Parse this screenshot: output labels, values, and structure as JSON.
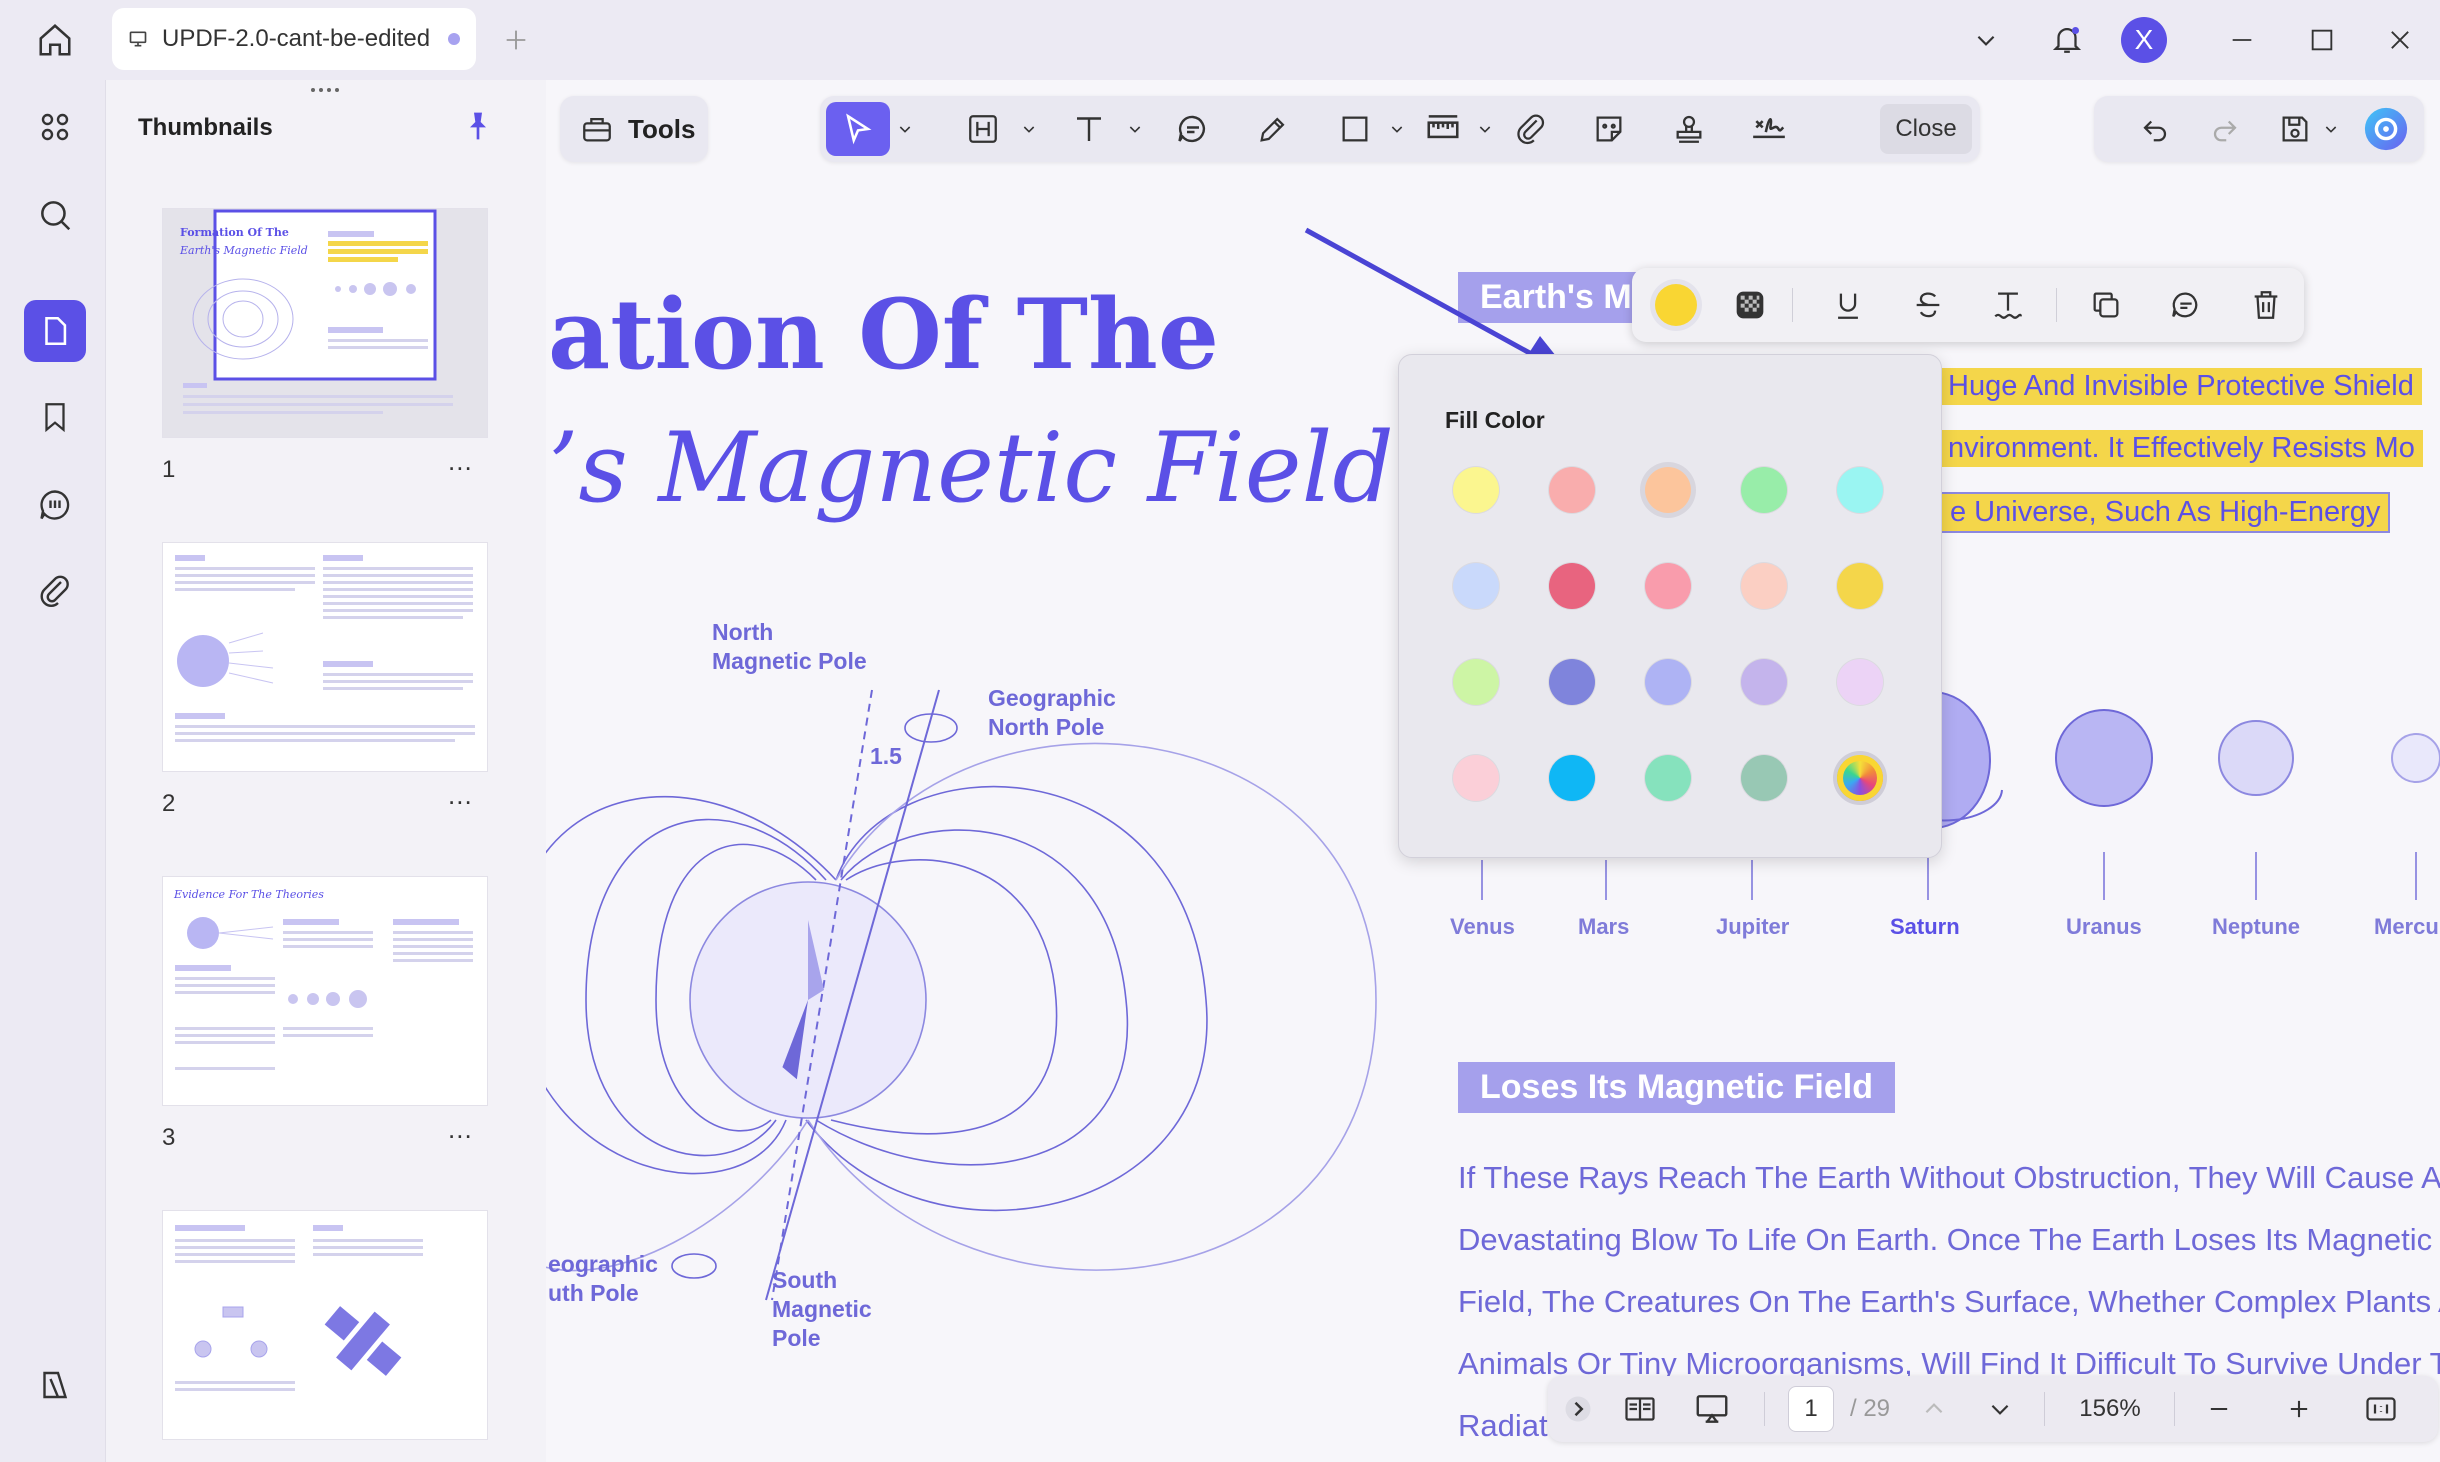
{
  "titlebar": {
    "doc_tab_title": "UPDF-2.0-cant-be-edited",
    "avatar_initial": "X"
  },
  "thumbnails": {
    "title": "Thumbnails",
    "pages": [
      {
        "number": "1",
        "more": "...",
        "heading": "Formation Of The",
        "subheading": "Earth's Magnetic Field"
      },
      {
        "number": "2",
        "more": "..."
      },
      {
        "number": "3",
        "more": "...",
        "heading": "Evidence For The Theories"
      },
      {
        "number": "",
        "more": ""
      }
    ]
  },
  "toolbar": {
    "tools_label": "Tools",
    "close_label": "Close"
  },
  "document": {
    "title_line1": "ation Of The",
    "title_line2": "’s Magnetic Field",
    "labels": {
      "north_magnetic": [
        "North",
        "Magnetic Pole"
      ],
      "geographic_north": [
        "Geographic",
        "North Pole"
      ],
      "angle": "1.5",
      "geographic_south": [
        "eographic",
        "uth Pole"
      ],
      "south_magnetic": [
        "South",
        "Magnetic",
        "Pole"
      ]
    },
    "section1_tag": "Earth's M",
    "highlight_lines": [
      "Huge And Invisible Protective Shield",
      "nvironment. It Effectively Resists Mo",
      "e Universe, Such As High-Energy"
    ],
    "planets": [
      "Venus",
      "Mars",
      "Jupiter",
      "Saturn",
      "Uranus",
      "Neptune",
      "Mercu"
    ],
    "section2_tag": "Loses Its Magnetic Field",
    "body_lines": [
      "If These Rays Reach The Earth Without Obstruction, They Will Cause A",
      "Devastating Blow To Life On Earth. Once The Earth Loses Its Magnetic",
      "Field, The Creatures On The Earth's Surface, Whether Complex Plants A",
      "Animals Or Tiny Microorganisms, Will Find It Difficult To Survive Under Th",
      "Radiat"
    ]
  },
  "fill_color": {
    "title": "Fill Color",
    "selected_color": "#f9d633",
    "swatches": [
      [
        "#fbf68f",
        "#f9adad",
        "#fcc59c",
        "#98eda9",
        "#9af5f2"
      ],
      [
        "#c9d9fb",
        "#e8647f",
        "#f99cac",
        "#fbcfc3",
        "#f4d64a"
      ],
      [
        "#cdf5a5",
        "#7f84dc",
        "#aeb3f4",
        "#c4b4ec",
        "#ecd3f6"
      ],
      [
        "#fbcfd8",
        "#0fb7f5",
        "#86e2bd",
        "#98c8b4",
        "rainbow"
      ]
    ]
  },
  "bottom_nav": {
    "current_page": "1",
    "total_pages": "/ 29",
    "zoom": "156%"
  },
  "colors": {
    "accent": "#5b50e6",
    "highlight": "#f4d64a"
  }
}
